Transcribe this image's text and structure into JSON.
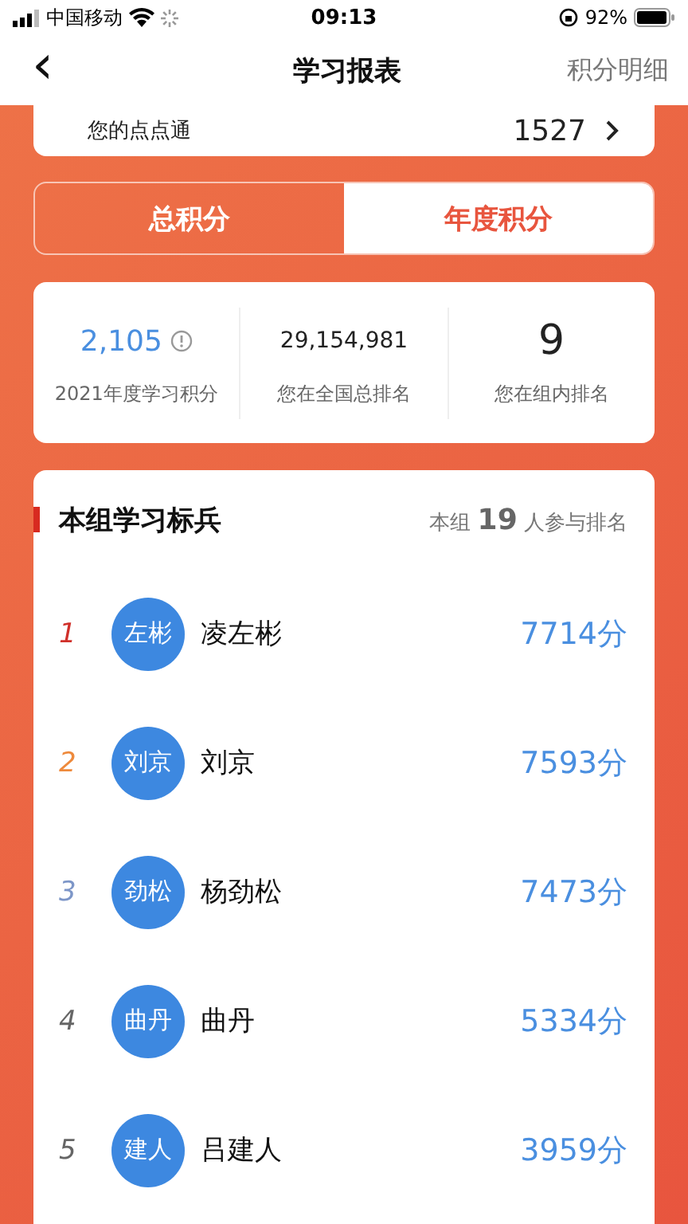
{
  "status_bar": {
    "carrier": "中国移动",
    "time": "09:13",
    "battery": "92%"
  },
  "nav": {
    "back": "‹",
    "title": "学习报表",
    "action": "积分明细"
  },
  "summary": {
    "label": "您的点点通",
    "value": "1527"
  },
  "tabs": [
    {
      "label": "总积分",
      "selected": false
    },
    {
      "label": "年度积分",
      "selected": true
    }
  ],
  "stats": [
    {
      "value": "2,105",
      "label": "2021年度学习积分",
      "kind": "info"
    },
    {
      "value": "29,154,981",
      "label": "您在全国总排名",
      "kind": "small"
    },
    {
      "value": "9",
      "label": "您在组内排名",
      "kind": "large"
    }
  ],
  "ranking": {
    "title": "本组学习标兵",
    "count_prefix": "本组",
    "count": "19",
    "count_suffix": "人参与排名",
    "rows": [
      {
        "rank": "1",
        "color": "#d0302a",
        "avatar": "左彬",
        "name": "凌左彬",
        "score": "7714分"
      },
      {
        "rank": "2",
        "color": "#ee8a3c",
        "avatar": "刘京",
        "name": "刘京",
        "score": "7593分"
      },
      {
        "rank": "3",
        "color": "#7d96c8",
        "avatar": "劲松",
        "name": "杨劲松",
        "score": "7473分"
      },
      {
        "rank": "4",
        "color": "#666666",
        "avatar": "曲丹",
        "name": "曲丹",
        "score": "5334分"
      },
      {
        "rank": "5",
        "color": "#666666",
        "avatar": "建人",
        "name": "吕建人",
        "score": "3959分"
      }
    ]
  }
}
